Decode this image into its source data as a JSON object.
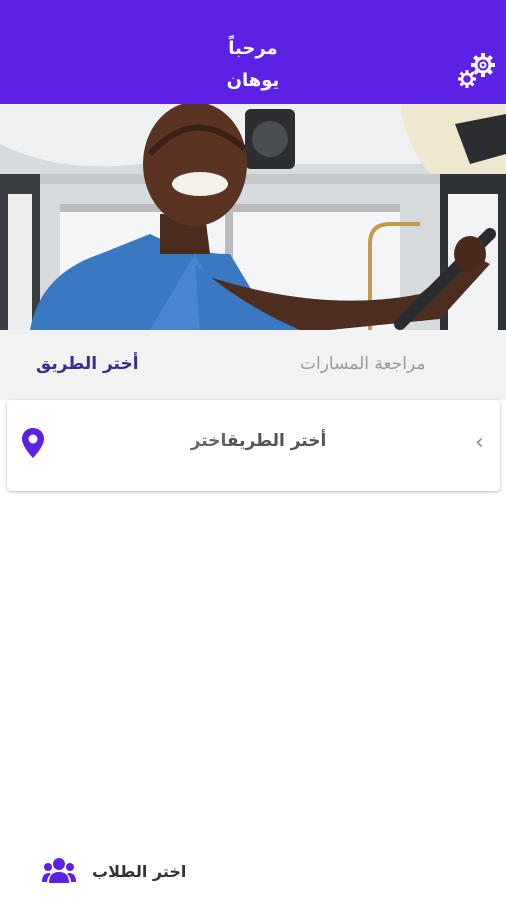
{
  "header": {
    "greeting": "مرحباً",
    "user_name": "يوهان",
    "settings_icon": "gear-icon",
    "background_color": "#5b22e6"
  },
  "hero": {
    "image": "photo of a smiling bus driver at the steering wheel"
  },
  "tabs": {
    "review_routes": "مراجعة المسارات",
    "choose_route": "أختر الطريق"
  },
  "route_card": {
    "prefix": "اختر",
    "value": "أختر الطريق",
    "location_icon": "location-pin-icon",
    "chevron_icon": "chevron-left-icon",
    "chevron": "‹"
  },
  "footer": {
    "choose_students": "اختر الطلاب",
    "students_icon": "group-users-icon"
  }
}
